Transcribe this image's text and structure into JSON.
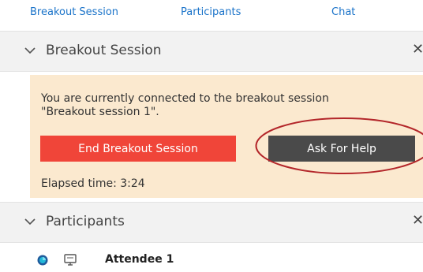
{
  "tabs": [
    "Breakout Session",
    "Participants",
    "Chat"
  ],
  "breakout_section": {
    "title": "Breakout Session",
    "message_line1": "You are currently connected to the breakout session",
    "message_line2": "\"Breakout session 1\".",
    "end_button": "End Breakout Session",
    "help_button": "Ask For Help",
    "elapsed": "Elapsed time: 3:24"
  },
  "participants_section": {
    "title": "Participants",
    "items": [
      {
        "name": "Attendee 1"
      }
    ]
  },
  "colors": {
    "link": "#1a73c9",
    "panel_bg": "#fbe9cf",
    "end_button_bg": "#f04539",
    "help_button_bg": "#4a4a4a",
    "highlight_ring": "#b3262a"
  },
  "icons": {
    "collapse": "chevron-down-icon",
    "close": "close-icon",
    "presence": "presence-icon",
    "screen": "screen-share-icon"
  }
}
